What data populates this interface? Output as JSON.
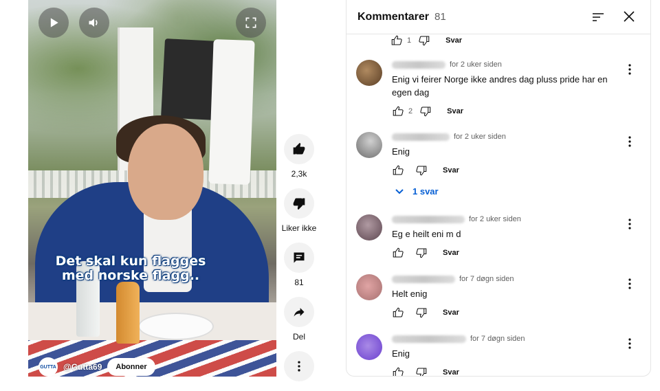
{
  "video": {
    "caption_line1": "Det skal kun flagges",
    "caption_line2": "med norske flagg..",
    "channel_logo_text": "GUTTA",
    "channel_name": "@Gutta69",
    "subscribe_label": "Abonner",
    "controls": [
      "play-icon",
      "volume-icon",
      "fullscreen-icon"
    ]
  },
  "actions": {
    "like_count": "2,3k",
    "dislike_label": "Liker ikke",
    "comment_count": "81",
    "share_label": "Del"
  },
  "comments_panel": {
    "title": "Kommentarer",
    "count": "81",
    "top_partial": {
      "likes": "1",
      "reply_label": "Svar"
    },
    "comments": [
      {
        "time": "for 2 uker siden",
        "text": "Enig vi feirer Norge ikke andres dag pluss pride har en egen dag",
        "likes": "2",
        "reply_label": "Svar",
        "avatar_color": "#7a5a3a"
      },
      {
        "time": "for 2 uker siden",
        "text": "Enig",
        "likes": "",
        "reply_label": "Svar",
        "replies_label": "1 svar",
        "avatar_color": "#8a8a8a"
      },
      {
        "time": "for 2 uker siden",
        "text": "Eg e heilt eni m d",
        "likes": "",
        "reply_label": "Svar",
        "avatar_color": "#8a6f78"
      },
      {
        "time": "for 7 døgn siden",
        "text": "Helt enig",
        "likes": "",
        "reply_label": "Svar",
        "avatar_color": "#c98c8c"
      },
      {
        "time": "for 7 døgn siden",
        "text": "Enig",
        "likes": "",
        "reply_label": "Svar",
        "avatar_color": "#8a5fd6"
      }
    ]
  }
}
